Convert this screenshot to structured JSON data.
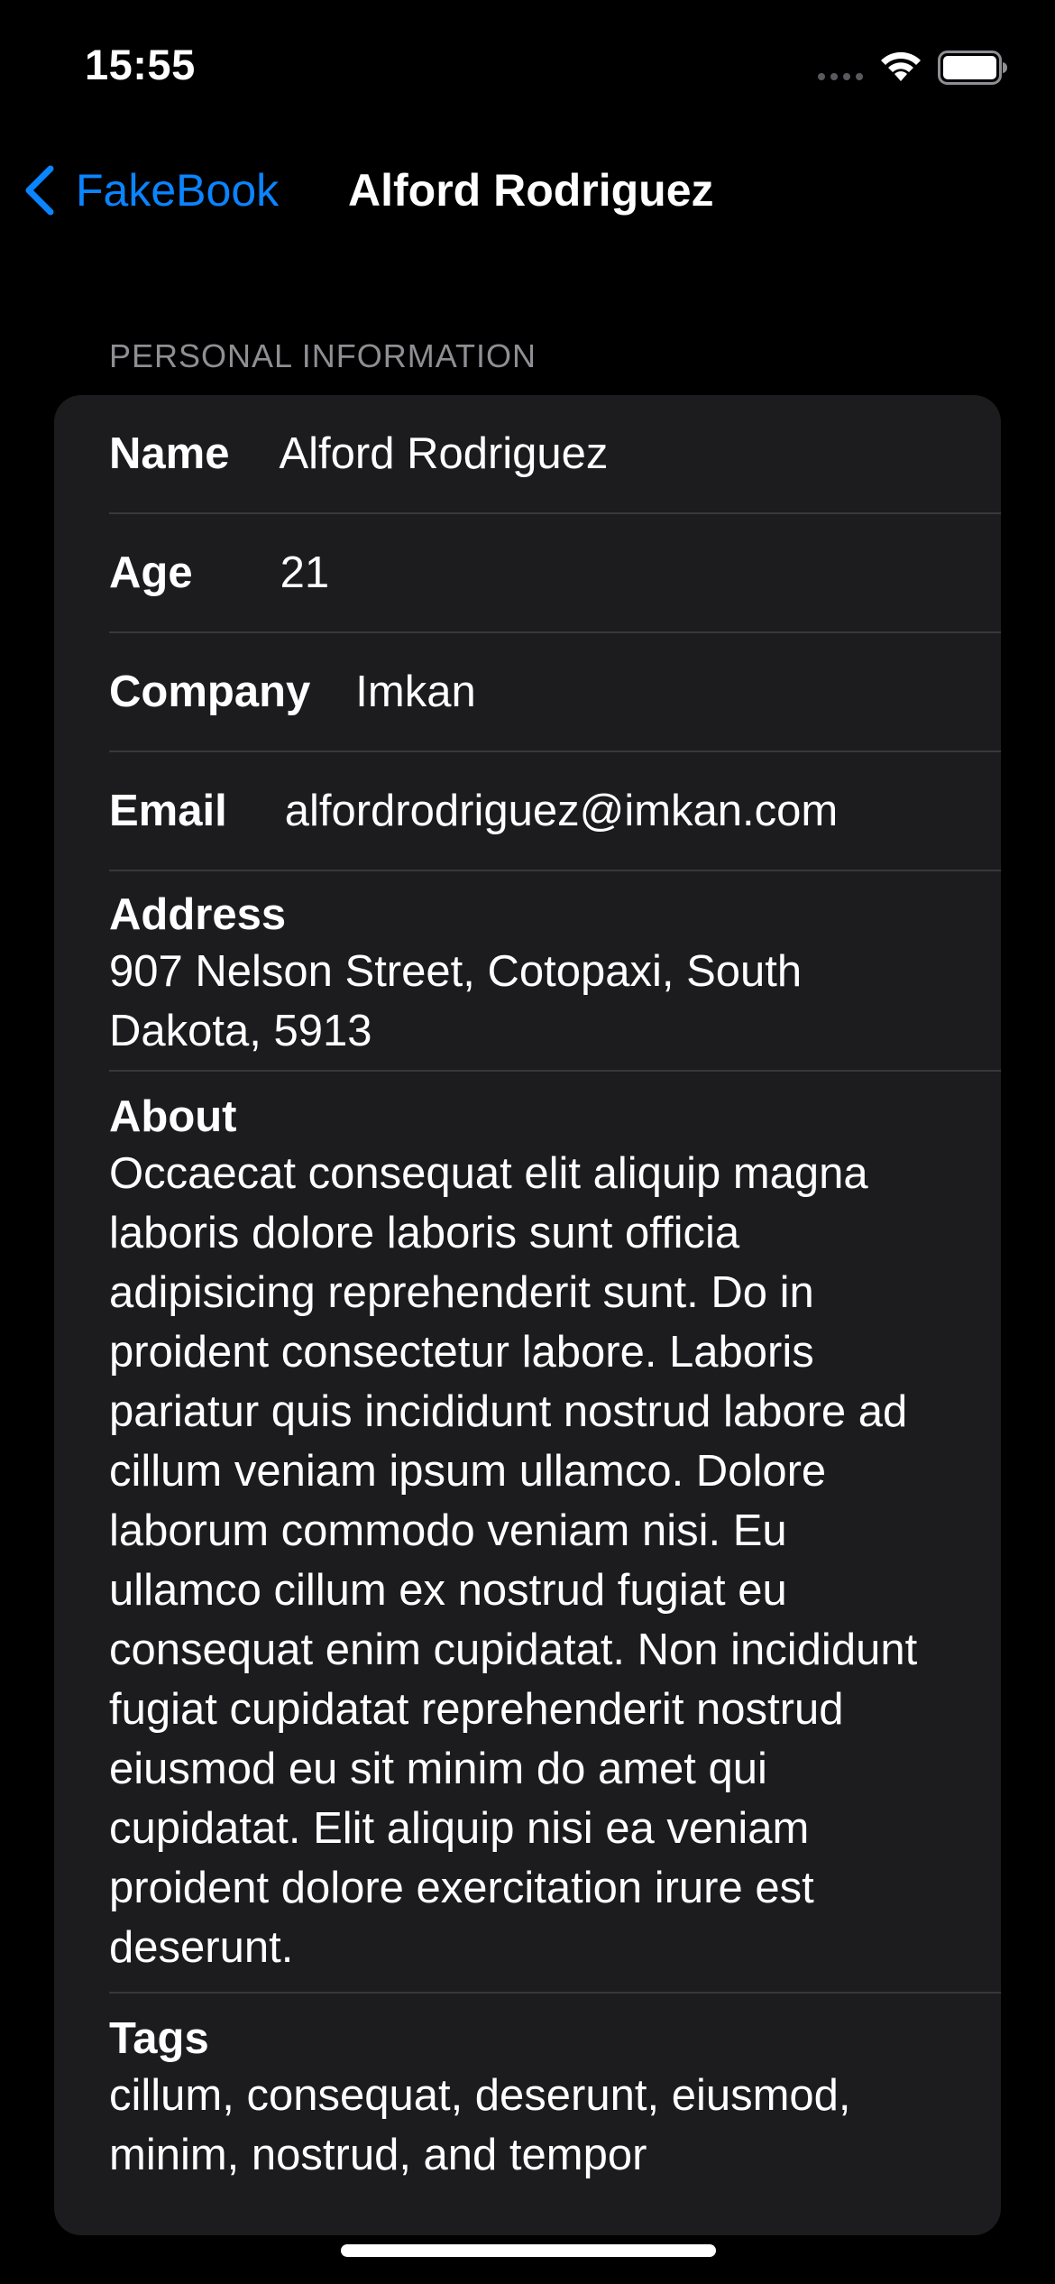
{
  "status_bar": {
    "time": "15:55"
  },
  "nav": {
    "back_label": "FakeBook",
    "title": "Alford Rodriguez"
  },
  "section": {
    "header": "PERSONAL INFORMATION"
  },
  "fields": {
    "name": {
      "label": "Name",
      "value": "Alford Rodriguez"
    },
    "age": {
      "label": "Age",
      "value": "21"
    },
    "company": {
      "label": "Company",
      "value": "Imkan"
    },
    "email": {
      "label": "Email",
      "value": "alfordrodriguez@imkan.com"
    },
    "address": {
      "label": "Address",
      "value": "907 Nelson Street, Cotopaxi, South Dakota, 5913"
    },
    "about": {
      "label": "About",
      "value": "Occaecat consequat elit aliquip magna laboris dolore laboris sunt officia adipisicing reprehenderit sunt. Do in proident consectetur labore. Laboris pariatur quis incididunt nostrud labore ad cillum veniam ipsum ullamco. Dolore laborum commodo veniam nisi. Eu ullamco cillum ex nostrud fugiat eu consequat enim cupidatat. Non incididunt fugiat cupidatat reprehenderit nostrud eiusmod eu sit minim do amet qui cupidatat. Elit aliquip nisi ea veniam proident dolore exercitation irure est deserunt."
    },
    "tags": {
      "label": "Tags",
      "value": "cillum, consequat, deserunt, eiusmod, minim, nostrud, and tempor"
    }
  },
  "colors": {
    "accent": "#0a84ff",
    "background": "#000000",
    "card": "#1c1c1e",
    "separator": "#38383a",
    "secondary_text": "#8e8e93"
  },
  "icons": {
    "back": "chevron-left-icon",
    "signal": "cellular-signal-icon",
    "wifi": "wifi-icon",
    "battery": "battery-icon"
  }
}
